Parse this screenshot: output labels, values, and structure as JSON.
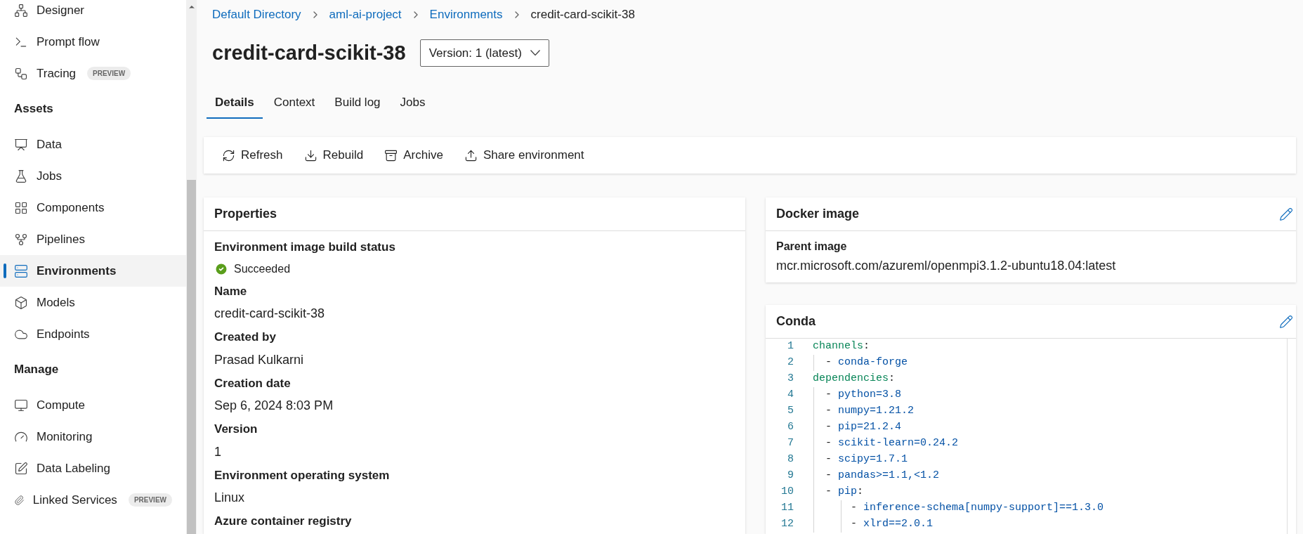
{
  "sidebar": {
    "items": [
      {
        "kind": "item",
        "label": "Designer",
        "selected": false
      },
      {
        "kind": "item",
        "label": "Prompt flow",
        "selected": false
      },
      {
        "kind": "item",
        "label": "Tracing",
        "badge": "PREVIEW",
        "selected": false
      },
      {
        "kind": "section",
        "label": "Assets"
      },
      {
        "kind": "item",
        "label": "Data",
        "selected": false
      },
      {
        "kind": "item",
        "label": "Jobs",
        "selected": false
      },
      {
        "kind": "item",
        "label": "Components",
        "selected": false
      },
      {
        "kind": "item",
        "label": "Pipelines",
        "selected": false
      },
      {
        "kind": "item",
        "label": "Environments",
        "selected": true
      },
      {
        "kind": "item",
        "label": "Models",
        "selected": false
      },
      {
        "kind": "item",
        "label": "Endpoints",
        "selected": false
      },
      {
        "kind": "section",
        "label": "Manage"
      },
      {
        "kind": "item",
        "label": "Compute",
        "selected": false
      },
      {
        "kind": "item",
        "label": "Monitoring",
        "selected": false
      },
      {
        "kind": "item",
        "label": "Data Labeling",
        "selected": false
      },
      {
        "kind": "item",
        "label": "Linked Services",
        "badge": "PREVIEW",
        "selected": false
      }
    ]
  },
  "breadcrumb": [
    "Default Directory",
    "aml-ai-project",
    "Environments",
    "credit-card-scikit-38"
  ],
  "title": "credit-card-scikit-38",
  "version_dropdown": "Version: 1 (latest)",
  "tabs": [
    {
      "label": "Details",
      "selected": true
    },
    {
      "label": "Context",
      "selected": false
    },
    {
      "label": "Build log",
      "selected": false
    },
    {
      "label": "Jobs",
      "selected": false
    }
  ],
  "toolbar": [
    "Refresh",
    "Rebuild",
    "Archive",
    "Share environment"
  ],
  "properties": {
    "title": "Properties",
    "fields": [
      {
        "label": "Environment image build status",
        "value": "Succeeded",
        "kind": "status"
      },
      {
        "label": "Name",
        "value": "credit-card-scikit-38",
        "kind": "text"
      },
      {
        "label": "Created by",
        "value": "Prasad Kulkarni",
        "kind": "text"
      },
      {
        "label": "Creation date",
        "value": "Sep 6, 2024 8:03 PM",
        "kind": "text"
      },
      {
        "label": "Version",
        "value": "1",
        "kind": "text"
      },
      {
        "label": "Environment operating system",
        "value": "Linux",
        "kind": "text"
      },
      {
        "label": "Azure container registry"
      }
    ]
  },
  "docker_image": {
    "title": "Docker image",
    "label": "Parent image",
    "value": "mcr.microsoft.com/azureml/openmpi3.1.2-ubuntu18.04:latest"
  },
  "conda": {
    "title": "Conda",
    "lines": [
      {
        "number": "1",
        "tokens": [
          {
            "kind": "key",
            "text": "channels"
          },
          {
            "kind": "punct",
            "text": ":"
          }
        ]
      },
      {
        "number": "2",
        "tokens": [
          {
            "kind": "punct",
            "text": "  - "
          },
          {
            "kind": "value",
            "text": "conda-forge"
          }
        ]
      },
      {
        "number": "3",
        "tokens": [
          {
            "kind": "key",
            "text": "dependencies"
          },
          {
            "kind": "punct",
            "text": ":"
          }
        ]
      },
      {
        "number": "4",
        "tokens": [
          {
            "kind": "punct",
            "text": "  - "
          },
          {
            "kind": "value",
            "text": "python=3.8"
          }
        ]
      },
      {
        "number": "5",
        "tokens": [
          {
            "kind": "punct",
            "text": "  - "
          },
          {
            "kind": "value",
            "text": "numpy=1.21.2"
          }
        ]
      },
      {
        "number": "6",
        "tokens": [
          {
            "kind": "punct",
            "text": "  - "
          },
          {
            "kind": "value",
            "text": "pip=21.2.4"
          }
        ]
      },
      {
        "number": "7",
        "tokens": [
          {
            "kind": "punct",
            "text": "  - "
          },
          {
            "kind": "value",
            "text": "scikit-learn=0.24.2"
          }
        ]
      },
      {
        "number": "8",
        "tokens": [
          {
            "kind": "punct",
            "text": "  - "
          },
          {
            "kind": "value",
            "text": "scipy=1.7.1"
          }
        ]
      },
      {
        "number": "9",
        "tokens": [
          {
            "kind": "punct",
            "text": "  - "
          },
          {
            "kind": "value",
            "text": "pandas>=1.1,<1.2"
          }
        ]
      },
      {
        "number": "10",
        "tokens": [
          {
            "kind": "punct",
            "text": "  - "
          },
          {
            "kind": "value",
            "text": "pip"
          },
          {
            "kind": "punct",
            "text": ":"
          }
        ]
      },
      {
        "number": "11",
        "tokens": [
          {
            "kind": "punct",
            "text": "      - "
          },
          {
            "kind": "value",
            "text": "inference-schema[numpy-support]==1.3.0"
          }
        ]
      },
      {
        "number": "12",
        "tokens": [
          {
            "kind": "punct",
            "text": "      - "
          },
          {
            "kind": "value",
            "text": "xlrd==2.0.1"
          }
        ]
      }
    ]
  }
}
